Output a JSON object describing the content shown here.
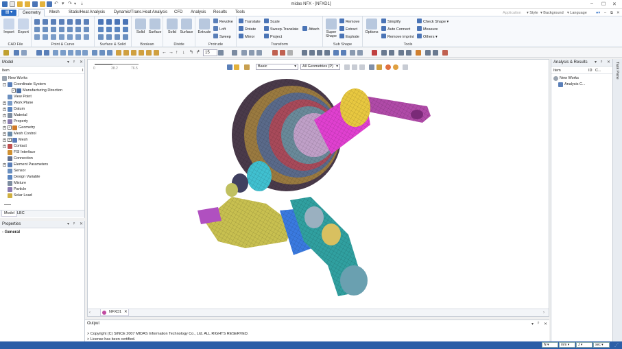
{
  "window": {
    "title": "midas NFX - [NFXD1]"
  },
  "menu": {
    "file_label": "",
    "tabs": [
      "Geometry",
      "Mesh",
      "Static/Heat Analysis",
      "Dynamic/Trans.Heat Analysis",
      "CFD",
      "Analysis",
      "Results",
      "Tools"
    ],
    "right": [
      "Application",
      "Style",
      "Background",
      "Language"
    ]
  },
  "ribbon": {
    "cad_file": {
      "label": "CAD File",
      "import": "Import",
      "export": "Export"
    },
    "point_curve": {
      "label": "Point & Curve"
    },
    "surface_solid": {
      "label": "Surface & Solid"
    },
    "boolean": {
      "label": "Boolean",
      "solid": "Solid",
      "surface": "Surface"
    },
    "divide": {
      "label": "Divide",
      "solid": "Solid",
      "surface": "Surface"
    },
    "protrude": {
      "label": "Protrude",
      "extrude": "Extrude",
      "revolve": "Revolve",
      "loft": "Loft",
      "sweep": "Sweep"
    },
    "transform": {
      "label": "Transform",
      "translate": "Translate",
      "rotate": "Rotate",
      "mirror": "Mirror",
      "scale": "Scale",
      "sweep_translate": "Sweep-Translate",
      "project": "Project",
      "attach": "Attach"
    },
    "sub_shape": {
      "label": "Sub Shape",
      "super_shape": "Super Shape",
      "remove": "Remove",
      "extract": "Extract",
      "explode": "Explode"
    },
    "tools": {
      "label": "Tools",
      "options": "Options",
      "simplify": "Simplify",
      "auto_connect": "Auto Connect",
      "remove_imprint": "Remove imprint",
      "check_shape": "Check Shape",
      "measure": "Measure",
      "others": "Others"
    }
  },
  "toolbar": {
    "zoom_value": "15"
  },
  "model_panel": {
    "title": "Model",
    "column": "Item",
    "items": [
      {
        "label": "New Works",
        "level": 0,
        "expand": "",
        "check": false,
        "color": "#9aa4b0"
      },
      {
        "label": "Coordinate System",
        "level": 1,
        "expand": "-",
        "check": false,
        "color": "#5a7fb8"
      },
      {
        "label": "Manufacturing Direction",
        "level": 2,
        "expand": "",
        "check": true,
        "color": "#4a6fa5"
      },
      {
        "label": "View Point",
        "level": 1,
        "expand": "",
        "check": false,
        "color": "#6a8fc0"
      },
      {
        "label": "Work Plane",
        "level": 1,
        "expand": "+",
        "check": false,
        "color": "#7a9cc8"
      },
      {
        "label": "Datum",
        "level": 1,
        "expand": "+",
        "check": false,
        "color": "#5a85c0"
      },
      {
        "label": "Material",
        "level": 1,
        "expand": "+",
        "check": false,
        "color": "#7d8da0"
      },
      {
        "label": "Property",
        "level": 1,
        "expand": "+",
        "check": false,
        "color": "#8a7ab0"
      },
      {
        "label": "Geometry",
        "level": 1,
        "expand": "+",
        "check": true,
        "color": "#d07a2a"
      },
      {
        "label": "Mesh Control",
        "level": 1,
        "expand": "+",
        "check": false,
        "color": "#6a8aa8"
      },
      {
        "label": "Mesh",
        "level": 1,
        "expand": "+",
        "check": true,
        "color": "#5a7ab8"
      },
      {
        "label": "Contact",
        "level": 1,
        "expand": "+",
        "check": false,
        "color": "#c05050"
      },
      {
        "label": "FSI Interface",
        "level": 1,
        "expand": "",
        "check": false,
        "color": "#d09030"
      },
      {
        "label": "Connection",
        "level": 1,
        "expand": "",
        "check": false,
        "color": "#607090"
      },
      {
        "label": "Element Parameters",
        "level": 1,
        "expand": "+",
        "check": false,
        "color": "#5a7fb8"
      },
      {
        "label": "Sensor",
        "level": 1,
        "expand": "",
        "check": false,
        "color": "#6a8fc0"
      },
      {
        "label": "Design Variable",
        "level": 1,
        "expand": "",
        "check": false,
        "color": "#5a85c0"
      },
      {
        "label": "Mixture",
        "level": 1,
        "expand": "",
        "check": false,
        "color": "#7d8da0"
      },
      {
        "label": "Particle",
        "level": 1,
        "expand": "",
        "check": false,
        "color": "#8a7ab0"
      },
      {
        "label": "Solar Load",
        "level": 1,
        "expand": "",
        "check": false,
        "color": "#d0b040"
      }
    ],
    "tabs": [
      "Model",
      "LBC"
    ]
  },
  "properties": {
    "title": "Properties",
    "section": "General"
  },
  "viewport": {
    "style_select": "Basic",
    "filter_select": "All Geometries (P)",
    "ruler_ticks": [
      "0",
      "38.2",
      "76.5"
    ],
    "doc_tab": "NFXD1"
  },
  "analysis_panel": {
    "title": "Analysis & Results",
    "columns": [
      "Item",
      "ID",
      "C..."
    ],
    "items": [
      {
        "label": "New Works",
        "level": 0
      },
      {
        "label": "Analysis C...",
        "level": 1
      }
    ]
  },
  "task_pane": {
    "label": "Task Pane"
  },
  "output": {
    "title": "Output",
    "lines": [
      "> Copyright (C) SINCE 2007 MIDAS Information Technology Co., Ltd. ALL RIGHTS RESERVED.",
      "> License has been certified."
    ]
  },
  "status": {
    "force": "N",
    "length": "mm",
    "time": "sec",
    "temp": "J"
  },
  "colors": {
    "accent": "#2b6cc4",
    "statusbar": "#2b5ea7",
    "ribbon_bg": "#f7f9fc"
  }
}
